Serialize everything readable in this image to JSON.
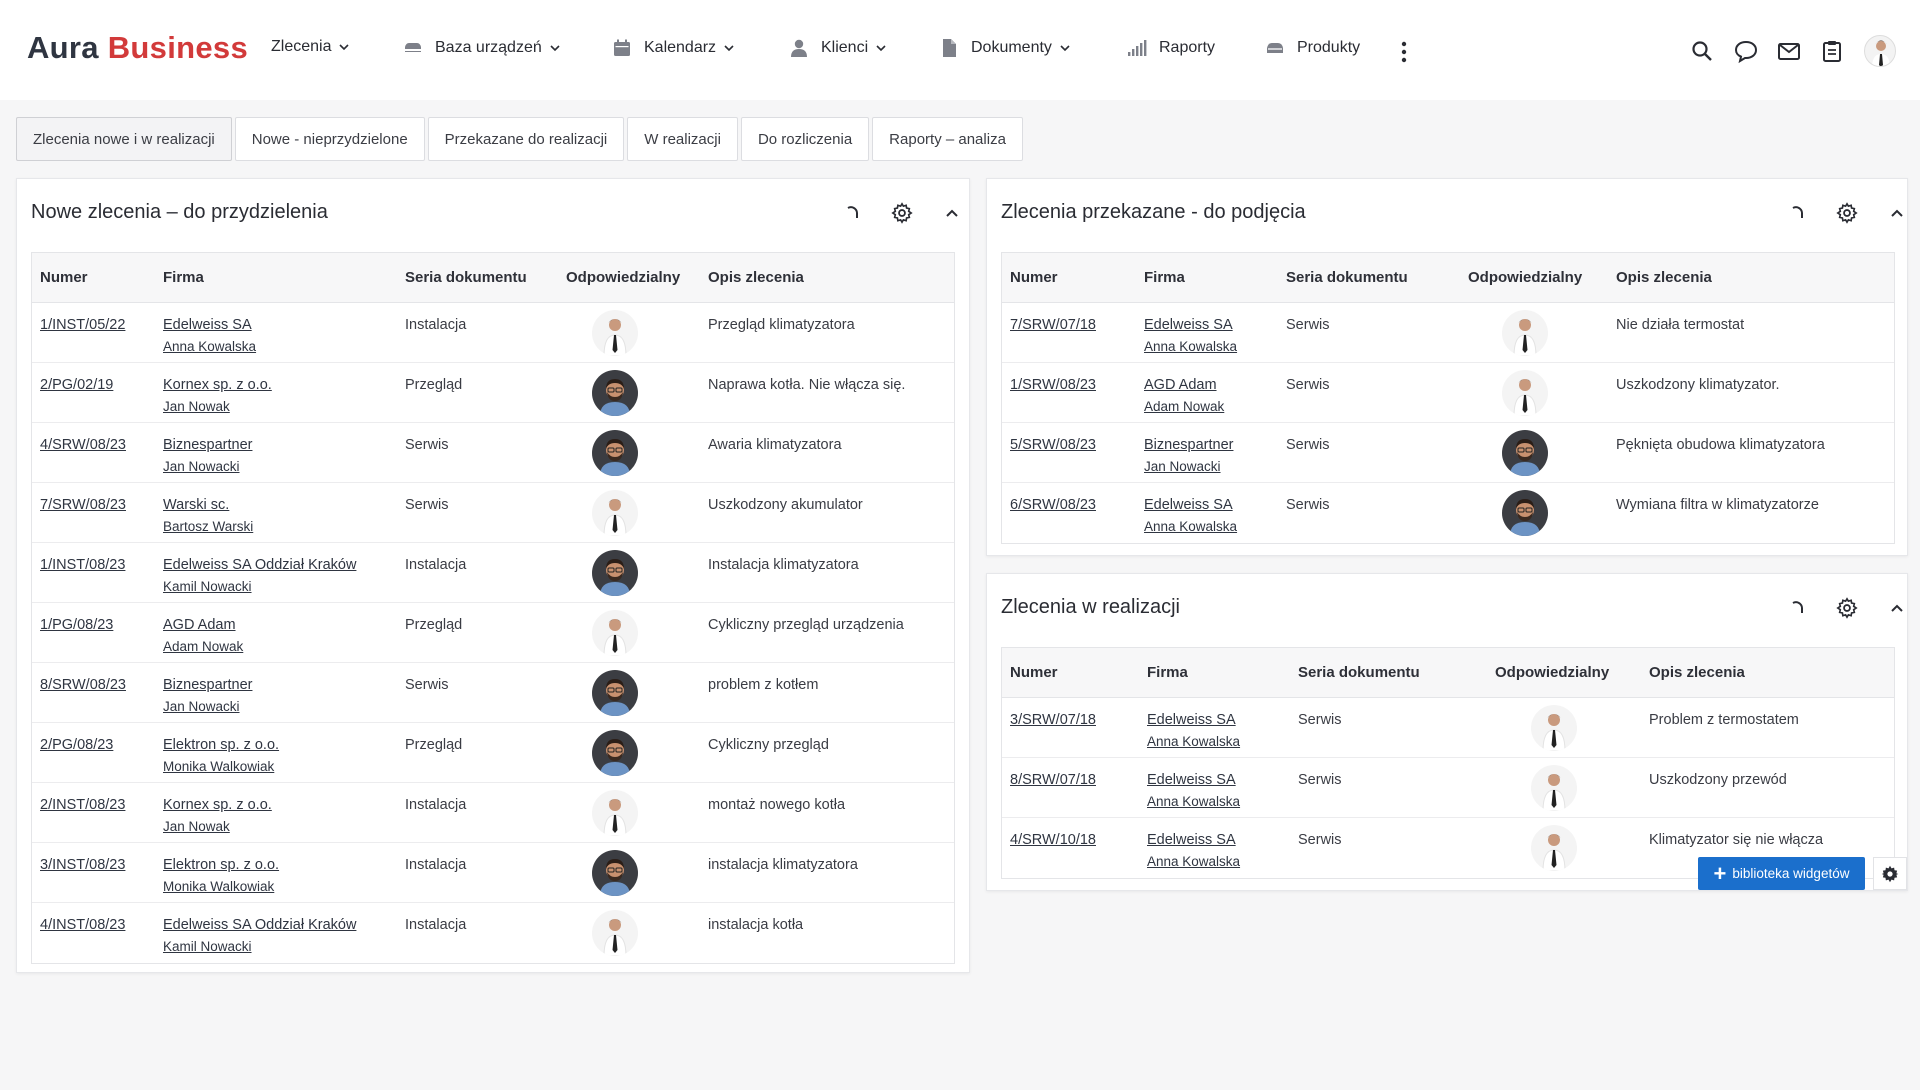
{
  "app": {
    "logo_part1": "Aura",
    "logo_part2": "Business"
  },
  "nav": [
    {
      "label": "Zlecenia",
      "icon": "none",
      "dropdown": true
    },
    {
      "label": "Baza urządzeń",
      "icon": "device-icon",
      "dropdown": true
    },
    {
      "label": "Kalendarz",
      "icon": "calendar-icon",
      "dropdown": true
    },
    {
      "label": "Klienci",
      "icon": "user-icon",
      "dropdown": true
    },
    {
      "label": "Dokumenty",
      "icon": "document-icon",
      "dropdown": true
    },
    {
      "label": "Raporty",
      "icon": "chart-icon",
      "dropdown": false
    },
    {
      "label": "Produkty",
      "icon": "box-icon",
      "dropdown": false
    }
  ],
  "tabs": [
    {
      "label": "Zlecenia nowe i w realizacji",
      "active": true
    },
    {
      "label": "Nowe - nieprzydzielone",
      "active": false
    },
    {
      "label": "Przekazane do realizacji",
      "active": false
    },
    {
      "label": "W realizacji",
      "active": false
    },
    {
      "label": "Do rozliczenia",
      "active": false
    },
    {
      "label": "Raporty – analiza",
      "active": false
    }
  ],
  "colors": {
    "accent": "#1b6fcc",
    "brand_red": "#d23a3a",
    "brand_dark": "#2f3541"
  },
  "panel_new": {
    "title": "Nowe zlecenia – do przydzielenia",
    "columns": [
      "Numer",
      "Firma",
      "Seria dokumentu",
      "Odpowiedzialny",
      "Opis zlecenia"
    ],
    "rows": [
      {
        "number": "1/INST/05/22",
        "company": "Edelweiss SA",
        "person": "Anna Kowalska",
        "series": "Instalacja",
        "avatar": "tie",
        "desc": "Przegląd klimatyzatora"
      },
      {
        "number": "2/PG/02/19",
        "company": "Kornex sp. z o.o.",
        "person": "Jan Nowak",
        "series": "Przegląd",
        "avatar": "beard",
        "desc": "Naprawa kotła. Nie włącza się."
      },
      {
        "number": "4/SRW/08/23",
        "company": "Biznespartner",
        "person": "Jan Nowacki",
        "series": "Serwis",
        "avatar": "beard",
        "desc": "Awaria klimatyzatora"
      },
      {
        "number": "7/SRW/08/23",
        "company": "Warski sc.",
        "person": "Bartosz Warski",
        "series": "Serwis",
        "avatar": "tie",
        "desc": "Uszkodzony akumulator"
      },
      {
        "number": "1/INST/08/23",
        "company": "Edelweiss SA Oddział Kraków",
        "person": "Kamil Nowacki",
        "series": "Instalacja",
        "avatar": "beard",
        "desc": "Instalacja klimatyzatora"
      },
      {
        "number": "1/PG/08/23",
        "company": "AGD Adam",
        "person": "Adam Nowak",
        "series": "Przegląd",
        "avatar": "tie",
        "desc": "Cykliczny przegląd urządzenia"
      },
      {
        "number": "8/SRW/08/23",
        "company": "Biznespartner",
        "person": "Jan Nowacki",
        "series": "Serwis",
        "avatar": "beard",
        "desc": "problem z kotłem"
      },
      {
        "number": "2/PG/08/23",
        "company": "Elektron sp. z o.o.",
        "person": "Monika Walkowiak",
        "series": "Przegląd",
        "avatar": "beard",
        "desc": "Cykliczny przegląd"
      },
      {
        "number": "2/INST/08/23",
        "company": "Kornex sp. z o.o.",
        "person": "Jan Nowak",
        "series": "Instalacja",
        "avatar": "tie",
        "desc": "montaż nowego kotła"
      },
      {
        "number": "3/INST/08/23",
        "company": "Elektron sp. z o.o.",
        "person": "Monika Walkowiak",
        "series": "Instalacja",
        "avatar": "beard",
        "desc": "instalacja klimatyzatora"
      },
      {
        "number": "4/INST/08/23",
        "company": "Edelweiss SA Oddział Kraków",
        "person": "Kamil Nowacki",
        "series": "Instalacja",
        "avatar": "tie",
        "desc": "instalacja kotła"
      }
    ]
  },
  "panel_transferred": {
    "title": "Zlecenia przekazane - do podjęcia",
    "columns": [
      "Numer",
      "Firma",
      "Seria dokumentu",
      "Odpowiedzialny",
      "Opis zlecenia"
    ],
    "rows": [
      {
        "number": "7/SRW/07/18",
        "company": "Edelweiss SA",
        "person": "Anna Kowalska",
        "series": "Serwis",
        "avatar": "tie",
        "desc": "Nie działa termostat"
      },
      {
        "number": "1/SRW/08/23",
        "company": "AGD Adam",
        "person": "Adam Nowak",
        "series": "Serwis",
        "avatar": "tie",
        "desc": "Uszkodzony klimatyzator."
      },
      {
        "number": "5/SRW/08/23",
        "company": "Biznespartner",
        "person": "Jan Nowacki",
        "series": "Serwis",
        "avatar": "beard",
        "desc": "Pęknięta obudowa klimatyzatora"
      },
      {
        "number": "6/SRW/08/23",
        "company": "Edelweiss SA",
        "person": "Anna Kowalska",
        "series": "Serwis",
        "avatar": "beard",
        "desc": "Wymiana filtra w klimatyzatorze"
      }
    ]
  },
  "panel_inprogress": {
    "title": "Zlecenia w realizacji",
    "columns": [
      "Numer",
      "Firma",
      "Seria dokumentu",
      "Odpowiedzialny",
      "Opis zlecenia"
    ],
    "rows": [
      {
        "number": "3/SRW/07/18",
        "company": "Edelweiss SA",
        "person": "Anna Kowalska",
        "series": "Serwis",
        "avatar": "tie",
        "desc": "Problem z termostatem"
      },
      {
        "number": "8/SRW/07/18",
        "company": "Edelweiss SA",
        "person": "Anna Kowalska",
        "series": "Serwis",
        "avatar": "tie",
        "desc": "Uszkodzony przewód"
      },
      {
        "number": "4/SRW/10/18",
        "company": "Edelweiss SA",
        "person": "Anna Kowalska",
        "series": "Serwis",
        "avatar": "tie",
        "desc": "Klimatyzator się nie włącza"
      }
    ]
  },
  "widget_library": {
    "label": "biblioteka widgetów"
  }
}
